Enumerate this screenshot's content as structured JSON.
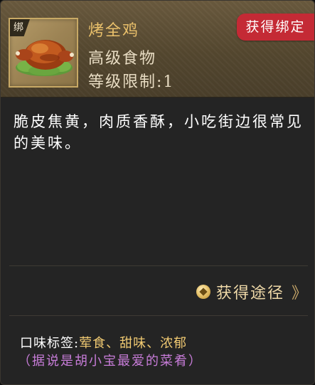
{
  "item": {
    "bind_tag": "绑",
    "name": "烤全鸡",
    "type": "高级食物",
    "level_limit": "等级限制:1",
    "acquire_bind": "获得绑定",
    "icon": "roast-chicken-icon"
  },
  "description": "脆皮焦黄，肉质香酥，小吃街边很常见的美味。",
  "obtain": {
    "label": "获得途径",
    "coin_icon": "coin-icon",
    "arrow": "》"
  },
  "taste": {
    "label": "口味标签:",
    "value": "荤食、甜味、浓郁"
  },
  "note": "（据说是胡小宝最爱的菜肴）",
  "colors": {
    "name": "#e9c06b",
    "badge": "#c42a35",
    "tag_value": "#f1ca72",
    "note": "#c77cd8"
  }
}
